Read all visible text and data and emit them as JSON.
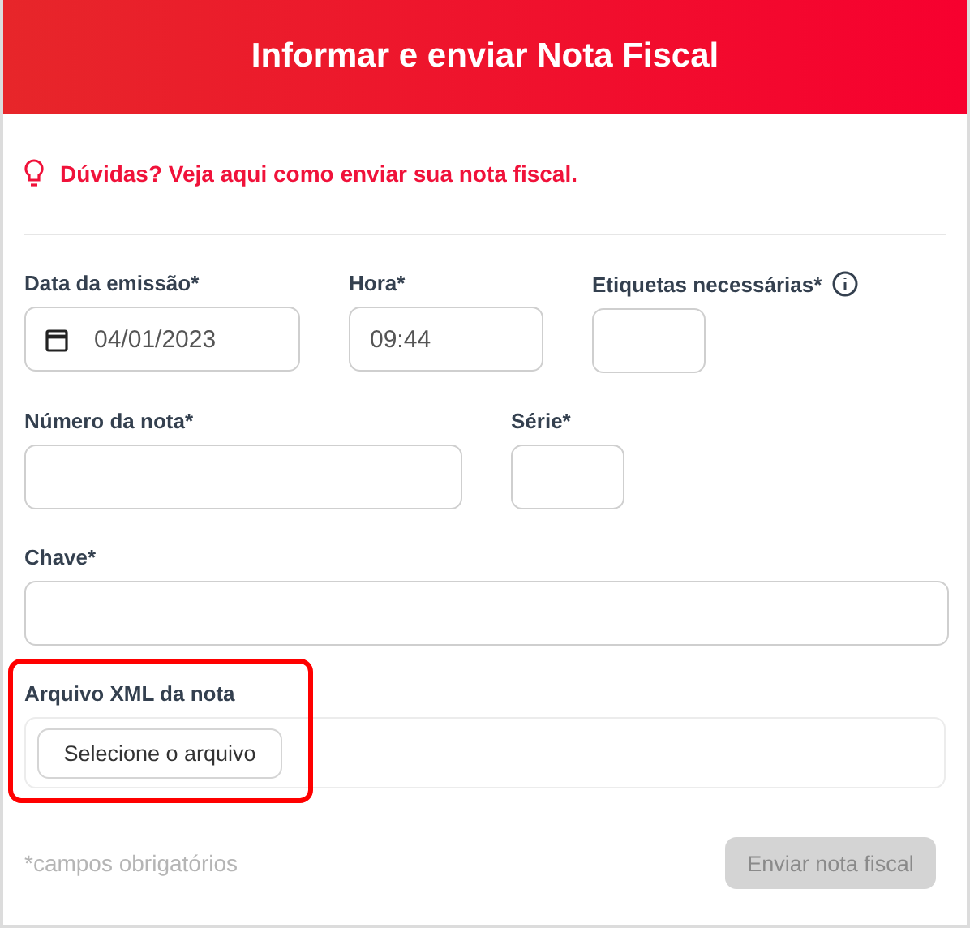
{
  "header": {
    "title": "Informar e enviar Nota Fiscal"
  },
  "help_link": {
    "text": "Dúvidas? Veja aqui como enviar sua nota fiscal."
  },
  "form_rows": [
    [
      {
        "label": "Data da emissão*",
        "kind": "date",
        "value": "04/01/2023",
        "info": false
      },
      {
        "label": "Hora*",
        "kind": "text",
        "value": "09:44",
        "info": false
      },
      {
        "label": "Etiquetas necessárias*",
        "kind": "text",
        "info": true
      }
    ],
    [
      {
        "label": "Número da nota*",
        "kind": "text",
        "info": false
      },
      {
        "label": "Série*",
        "kind": "text",
        "info": false
      }
    ],
    [
      {
        "label": "Chave*",
        "kind": "text",
        "info": false
      }
    ]
  ],
  "file_upload": {
    "label": "Arquivo XML da nota",
    "button": "Selecione o arquivo",
    "highlighted": true
  },
  "footer": {
    "note": "*campos obrigatórios",
    "submit": {
      "label": "Enviar nota fiscal",
      "disabled": true
    }
  }
}
